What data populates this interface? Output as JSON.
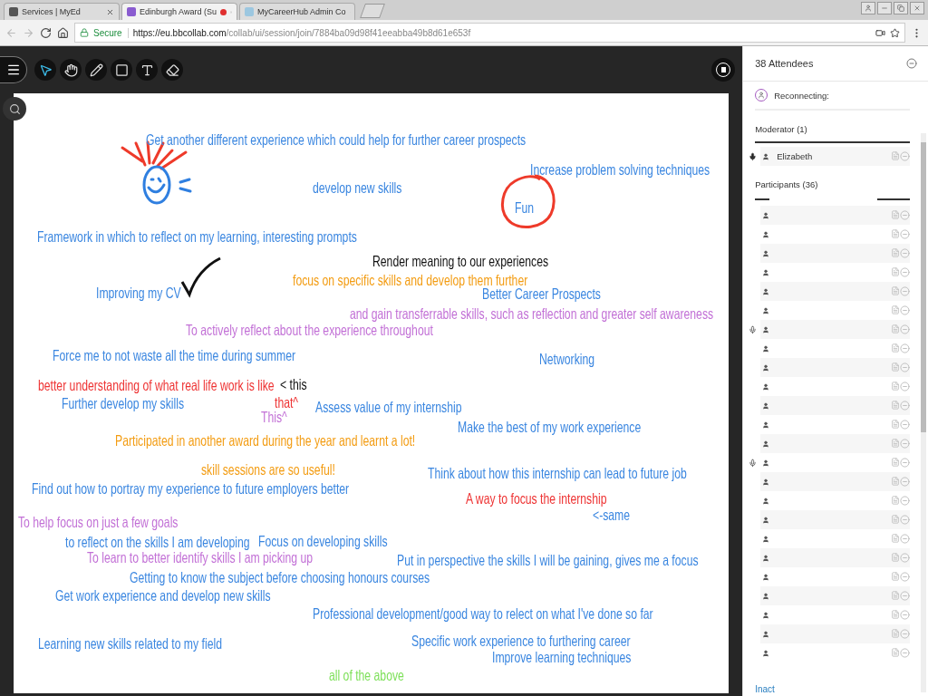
{
  "browser": {
    "tabs": [
      {
        "title": "Services | MyEd",
        "selected": false,
        "recording": false
      },
      {
        "title": "Edinburgh Award (Su",
        "selected": true,
        "recording": true
      },
      {
        "title": "MyCareerHub Admin Co",
        "selected": false,
        "recording": false
      }
    ],
    "address": {
      "security": "Secure",
      "host": "https://eu.bbcollab.com",
      "path": "/collab/ui/session/join/7884ba09d98f41eeabba49b8d61e653f"
    }
  },
  "toolbar": {
    "tools": [
      {
        "kind": "pointer",
        "selected": true
      },
      {
        "kind": "pan",
        "selected": false
      },
      {
        "kind": "pen",
        "selected": false
      },
      {
        "kind": "shape",
        "selected": false
      },
      {
        "kind": "text",
        "selected": false
      },
      {
        "kind": "eraser",
        "selected": false
      }
    ]
  },
  "whiteboard": {
    "notes": [
      {
        "text": "Get another different experience which could help for further career prospects",
        "color": "#3a86e0"
      },
      {
        "text": "develop new skills",
        "color": "#3a86e0"
      },
      {
        "text": "Increase problem solving techniques",
        "color": "#3a86e0"
      },
      {
        "text": "Fun",
        "color": "#3a86e0"
      },
      {
        "text": "Framework in which to reflect on my learning, interesting prompts",
        "color": "#3a86e0"
      },
      {
        "text": "Render meaning to our experiences",
        "color": "#111111"
      },
      {
        "text": "focus on specific skills and develop them further",
        "color": "#f39c12"
      },
      {
        "text": "Improving my CV",
        "color": "#3a86e0"
      },
      {
        "text": "Better Career Prospects",
        "color": "#3a86e0"
      },
      {
        "text": "and gain transferrable skills, such as reflection and greater self awareness",
        "color": "#c270d6"
      },
      {
        "text": "To actively reflect about the experience throughout",
        "color": "#c270d6"
      },
      {
        "text": "Force me to not waste all the time during summer",
        "color": "#3a86e0"
      },
      {
        "text": "Networking",
        "color": "#3a86e0"
      },
      {
        "text": "better understanding of what real life work is like",
        "color": "#ee3333"
      },
      {
        "text": "< this",
        "color": "#111111"
      },
      {
        "text": "Further develop my skills",
        "color": "#3a86e0"
      },
      {
        "text": "that^",
        "color": "#ee3333"
      },
      {
        "text": "This^",
        "color": "#c270d6"
      },
      {
        "text": "Assess value of my internship",
        "color": "#3a86e0"
      },
      {
        "text": "Make the best of my work experience",
        "color": "#3a86e0"
      },
      {
        "text": "Participated in another award during the year and learnt a lot!",
        "color": "#f39c12"
      },
      {
        "text": "skill sessions are so useful!",
        "color": "#f39c12"
      },
      {
        "text": "Think about how this internship can lead to future job",
        "color": "#3a86e0"
      },
      {
        "text": "Find out how to portray my experience to future employers better",
        "color": "#3a86e0"
      },
      {
        "text": "A way to focus the internship",
        "color": "#ee3333"
      },
      {
        "text": "<-same",
        "color": "#3a86e0"
      },
      {
        "text": "To help focus on just a few goals",
        "color": "#c270d6"
      },
      {
        "text": "to reflect on the skills I am developing",
        "color": "#3a86e0"
      },
      {
        "text": "Focus on developing skills",
        "color": "#3a86e0"
      },
      {
        "text": "To learn to better identify skills I am picking up",
        "color": "#c270d6"
      },
      {
        "text": "Put in perspective the skills I will be gaining, gives me a focus",
        "color": "#3a86e0"
      },
      {
        "text": "Getting to know the subject before choosing honours courses",
        "color": "#3a86e0"
      },
      {
        "text": "Get work experience and develop new skills",
        "color": "#3a86e0"
      },
      {
        "text": "Professional development/good way to relect on what I've done so far",
        "color": "#3a86e0"
      },
      {
        "text": "Learning new skills related to my field",
        "color": "#3a86e0"
      },
      {
        "text": "Specific work experience to furthering career",
        "color": "#3a86e0"
      },
      {
        "text": "Improve learning techniques",
        "color": "#3a86e0"
      },
      {
        "text": "all of the above",
        "color": "#7ee05a"
      }
    ]
  },
  "attendees": {
    "title": "38 Attendees",
    "status": "Reconnecting:",
    "moderator_heading": "Moderator (1)",
    "moderators": [
      {
        "name": "Elizabeth",
        "mic": true
      }
    ],
    "participants_heading": "Participants (36)",
    "participants": [
      {
        "mic": false
      },
      {
        "mic": false
      },
      {
        "mic": false
      },
      {
        "mic": false
      },
      {
        "mic": false
      },
      {
        "mic": false
      },
      {
        "mic": true
      },
      {
        "mic": false
      },
      {
        "mic": false
      },
      {
        "mic": false
      },
      {
        "mic": false
      },
      {
        "mic": false
      },
      {
        "mic": false
      },
      {
        "mic": true
      },
      {
        "mic": false
      },
      {
        "mic": false
      },
      {
        "mic": false
      },
      {
        "mic": false
      },
      {
        "mic": false
      },
      {
        "mic": false
      },
      {
        "mic": false
      },
      {
        "mic": false
      },
      {
        "mic": false
      },
      {
        "mic": false
      }
    ],
    "footer": "Inact"
  }
}
